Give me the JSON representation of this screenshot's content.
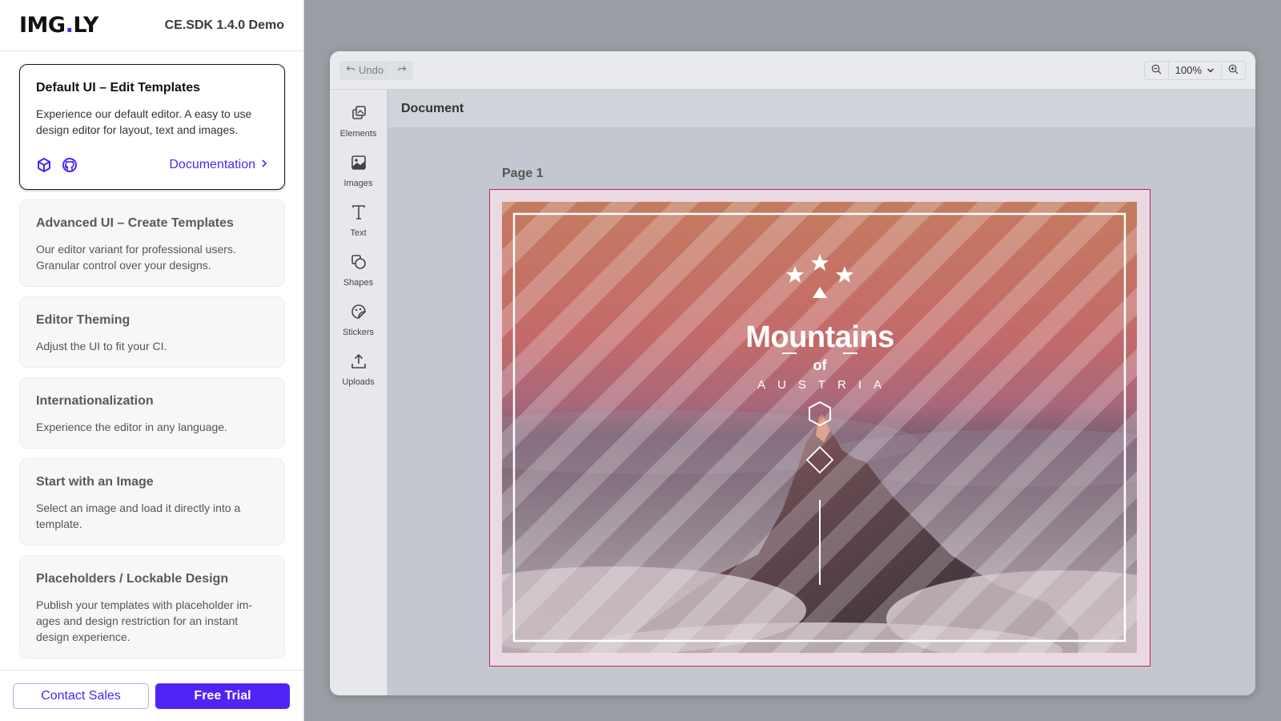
{
  "brand": {
    "logo_left": "IMG",
    "logo_dot": ".",
    "logo_right": "LY",
    "demo_title": "CE.SDK 1.4.0 Demo",
    "accent": "#4f24f5"
  },
  "sidebar": {
    "cards": [
      {
        "title": "Default UI – Edit Templates",
        "desc": "Experience our default editor. A easy to use design editor for layout, text and images.",
        "link": "Documentation"
      },
      {
        "title": "Advanced UI – Create Templates",
        "desc": "Our editor variant for professional users. Granular control over your designs."
      },
      {
        "title": "Editor Theming",
        "desc": "Adjust the UI to fit your CI."
      },
      {
        "title": "Internationalization",
        "desc": "Experience the editor in any language."
      },
      {
        "title": "Start with an Image",
        "desc": "Select an image and load it directly into a template."
      },
      {
        "title": "Placeholders / Lockable Design",
        "desc": "Publish your templates with placeholder im-ages and design restriction for an instant design experience."
      }
    ],
    "contact_label": "Contact Sales",
    "trial_label": "Free Trial"
  },
  "toolbar": {
    "undo_label": "Undo",
    "zoom": "100%"
  },
  "rail": [
    {
      "label": "Elements",
      "icon": "elements-icon"
    },
    {
      "label": "Images",
      "icon": "image-icon"
    },
    {
      "label": "Text",
      "icon": "text-icon"
    },
    {
      "label": "Shapes",
      "icon": "shapes-icon"
    },
    {
      "label": "Stickers",
      "icon": "sticker-icon"
    },
    {
      "label": "Uploads",
      "icon": "upload-icon"
    }
  ],
  "document": {
    "title": "Document",
    "page_label": "Page 1"
  },
  "poster": {
    "title": "Mountains",
    "of": "of",
    "subtitle": "AUSTRIA"
  },
  "colors": {
    "selection": "#c0235a",
    "sky_top": "#c47a5e",
    "sky_mid": "#c26a6a",
    "mountain": "#4a3d42"
  }
}
